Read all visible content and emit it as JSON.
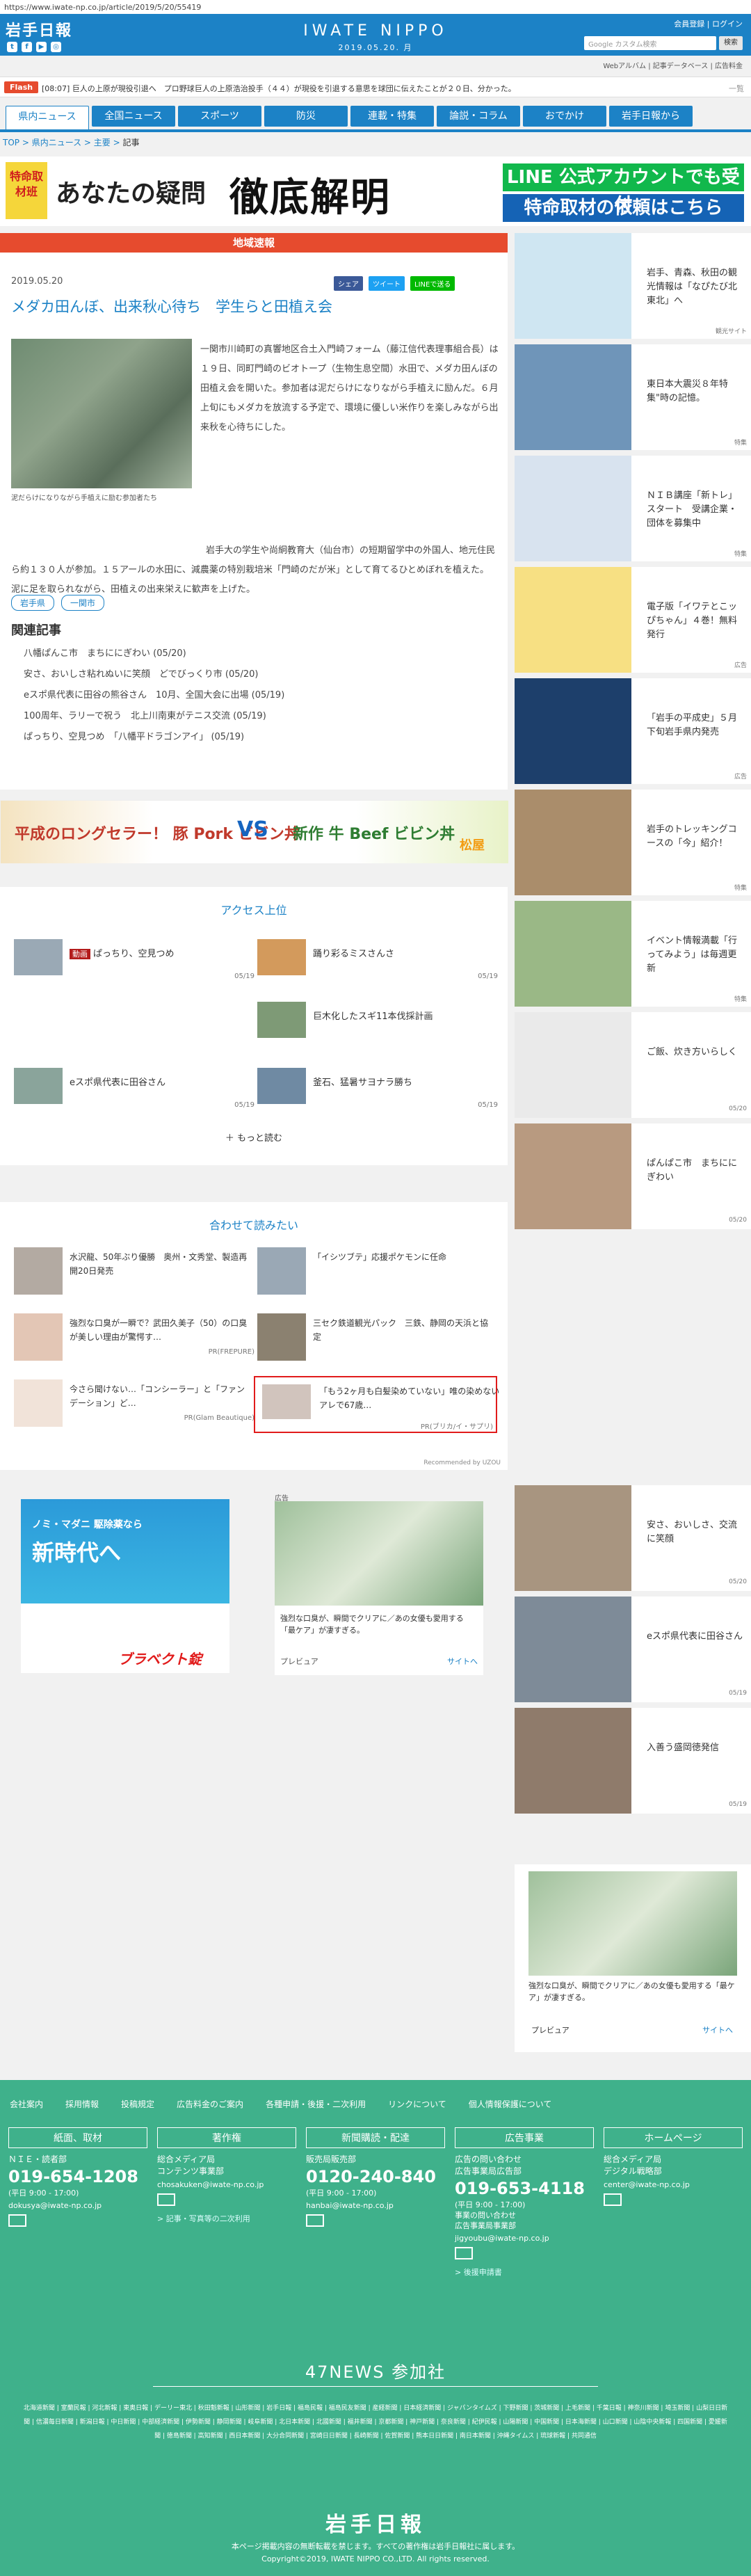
{
  "browser": {
    "url": "https://www.iwate-np.co.jp/article/2019/5/20/55419"
  },
  "header": {
    "logo": "岩手日報",
    "center_logo": "IWATE NIPPO",
    "date": "2019.05.20. 月",
    "links": "会員登録 | ログイン",
    "search_placeholder": "Google カスタム検索",
    "search_button": "検索",
    "social": [
      "t",
      "f",
      "▶",
      "◎"
    ],
    "sublinks": "Webアルバム | 記事データベース | 広告料金"
  },
  "flash": {
    "label": "Flash",
    "text": "[08:07] 巨人の上原が現役引退へ　プロ野球巨人の上原浩治投手（４４）が現役を引退する意思を球団に伝えたことが２０日、分かった。",
    "more": "一覧"
  },
  "nav": [
    "県内ニュース",
    "全国ニュース",
    "スポーツ",
    "防災",
    "連載・特集",
    "論説・コラム",
    "おでかけ",
    "岩手日報から"
  ],
  "breadcrumb": {
    "top": "TOP",
    "sep": " > ",
    "news": "県内ニュース",
    "main": "主要",
    "current": "記事"
  },
  "bannerA": {
    "tag": "特命取材班",
    "title1": "あなたの疑問",
    "title2": "徹底解明",
    "line1": "LINE 公式アカウントでも受付",
    "line2": "特命取材の依頼はこちら"
  },
  "article": {
    "section": "地域速報",
    "date": "2019.05.20",
    "share": [
      "シェア",
      "ツイート",
      "LINEで送る"
    ],
    "title": "メダカ田んぼ、出来秋心待ち　学生らと田植え会",
    "caption": "泥だらけになりながら手植えに励む参加者たち",
    "body1": "一関市川崎町の真響地区合土入門崎フォーム（藤江信代表理事組合長）は１９日、同町門崎のビオトープ（生物生息空間）水田で、メダカ田んぼの田植え会を開いた。参加者は泥だらけになりながら手植えに励んだ。６月上旬にもメダカを放流する予定で、環境に優しい米作りを楽しみながら出来秋を心待ちにした。",
    "body2": "岩手大の学生や尚絅教育大（仙台市）の短期留学中の外国人、地元住民ら約１３０人が参加。１５アールの水田に、減農薬の特別栽培米「門崎のだが米」として育てるひとめぼれを植えた。泥に足を取られながら、田植えの出来栄えに歓声を上げた。",
    "tags": [
      "岩手県",
      "一関市"
    ],
    "related_title": "関連記事",
    "related": [
      "八幡ぱんこ市　まちににぎわい (05/20)",
      "安さ、おいしさ粘れぬいに笑顔　どでびっくり市 (05/20)",
      "eスポ県代表に田谷の熊谷さん　10月、全国大会に出場 (05/19)",
      "100周年、ラリーで祝う　北上川南東がテニス交流 (05/19)",
      "ぱっちり、空見つめ　「八幡平ドラゴンアイ」 (05/19)"
    ]
  },
  "bannerB": {
    "left": "平成のロングセラー！ 豚 Pork ビビン丼",
    "vs": "VS",
    "right": "新作 牛 Beef ビビン丼",
    "brand": "松屋"
  },
  "access": {
    "title": "アクセス上位",
    "items": [
      {
        "badge": "動画",
        "text": "ぱっちり、空見つめ",
        "date": "05/19"
      },
      {
        "text": "踊り彩るミスさんさ",
        "date": "05/19"
      },
      {
        "text": "巨木化したスギ11本伐採計画",
        "date": ""
      },
      {
        "text": "eスポ県代表に田谷さん",
        "date": "05/19"
      },
      {
        "text": "釜石、猛暑サヨナラ勝ち",
        "date": "05/19"
      }
    ],
    "more": "＋ もっと読む"
  },
  "recommend": {
    "title": "合わせて読みたい",
    "items": [
      {
        "text": "水沢龍、50年ぶり優勝　奥州・文秀堂、製造再開20日発売",
        "pr": ""
      },
      {
        "text": "「イシツブテ」応援ポケモンに任命",
        "pr": ""
      },
      {
        "text": "強烈な口臭が一瞬で？武田久美子（50）の口臭が美しい理由が驚愕す…",
        "pr": "PR(FREPURE)"
      },
      {
        "text": "三セク鉄道観光パック　三鉄、静岡の天浜と協定",
        "pr": ""
      },
      {
        "text": "今さら聞けない…「コンシーラー」と「ファンデーション」ど…",
        "pr": "PR(Glam Beautique)"
      },
      {
        "text": "「もう2ヶ月も白髪染めていない」唯の染めないアレで67歳…",
        "pr": "PR(ブリカ/イ・サプリ)"
      }
    ],
    "by": "Recommended by UZOU"
  },
  "ads": {
    "ad1_line1": "ノミ・マダニ 駆除薬なら",
    "ad1_line2": "新時代へ",
    "ad1_brand": "ブラベクト錠",
    "ad_label": "広告",
    "ad2_text": "強烈な口臭が、瞬間でクリアに／あの女優も愛用する「最ケア」が凄すぎる。",
    "ad2_src": "プレビュア",
    "ad2_site": "サイトへ"
  },
  "sidebar": [
    {
      "text": "岩手、青森、秋田の観光情報は「なぴたび北東北」へ",
      "date": "観光サイト",
      "color": "#cfe6f2"
    },
    {
      "text": "東日本大震災８年特集\"時の記憶。",
      "date": "特集",
      "color": "#6f95b9"
    },
    {
      "text": "ＮＩＢ講座「新トレ」スタート　受講企業・団体を募集中",
      "date": "特集",
      "color": "#d8e3ef"
    },
    {
      "text": "電子版「イワテとこッぴちゃん」４巻！無料発行",
      "date": "広告",
      "color": "#f7e083"
    },
    {
      "text": "「岩手の平成史」５月下旬岩手県内発売",
      "date": "広告",
      "color": "#1d3f6b"
    },
    {
      "text": "岩手のトレッキングコースの「今」紹介！",
      "date": "特集",
      "color": "#aa8d6b"
    },
    {
      "text": "イベント情報満載「行ってみよう」は毎週更新",
      "date": "特集",
      "color": "#9ab886"
    },
    {
      "text": "ご飯、炊き方いらしく",
      "date": "05/20",
      "color": "#eaeaea"
    },
    {
      "text": "ぱんぱこ市　まちににぎわい",
      "date": "05/20",
      "color": "#b89a80"
    },
    {
      "text": "安さ、おいしさ、交流に笑顔",
      "date": "05/20",
      "color": "#a89580"
    },
    {
      "text": "eスポ県代表に田谷さん",
      "date": "05/19",
      "color": "#7e8b98"
    },
    {
      "text": "入善う盛岡徳発信",
      "date": "05/19",
      "color": "#8f7b6b"
    }
  ],
  "footer": {
    "links": [
      "会社案内",
      "採用情報",
      "投稿規定",
      "広告料金のご案内",
      "各種申請・後援・二次利用",
      "リンクについて",
      "個人情報保護について"
    ],
    "cols": [
      {
        "head": "紙面、取材",
        "sub": "ＮＩＥ・読者部",
        "phone": "019-654-1208",
        "hours": "(平日 9:00 - 17:00)",
        "mail": "dokusya@iwate-np.co.jp",
        "link": ""
      },
      {
        "head": "著作権",
        "sub": "総合メディア局\nコンテンツ事業部",
        "phone": "",
        "hours": "",
        "mail": "chosakuken@iwate-np.co.jp",
        "link": "> 記事・写真等の二次利用"
      },
      {
        "head": "新聞購読・配達",
        "sub": "販売局販売部",
        "phone": "0120-240-840",
        "hours": "(平日 9:00 - 17:00)",
        "mail": "hanbai@iwate-np.co.jp",
        "link": ""
      },
      {
        "head": "広告事業",
        "sub": "広告の問い合わせ\n広告事業局広告部",
        "phone": "019-653-4118",
        "hours": "(平日 9:00 - 17:00)\n事業の問い合わせ\n広告事業局事業部",
        "mail": "jigyoubu@iwate-np.co.jp",
        "link": "> 後援申請書"
      },
      {
        "head": "ホームページ",
        "sub": "総合メディア局\nデジタル戦略部",
        "phone": "",
        "hours": "",
        "mail": "center@iwate-np.co.jp",
        "link": ""
      }
    ],
    "news47": "47NEWS 参加社",
    "papers": "北海道新聞 | 室蘭民報 | 河北新報 | 東奥日報 | デーリー東北 | 秋田魁新報 | 山形新聞 | 岩手日報 | 福島民報 | 福島民友新聞 | 産経新聞 | 日本経済新聞 | ジャパンタイムズ | 下野新聞 | 茨城新聞 | 上毛新聞 | 千葉日報 | 神奈川新聞 | 埼玉新聞 | 山梨日日新聞 | 信濃毎日新聞 | 新潟日報 | 中日新聞 | 中部経済新聞 | 伊勢新聞 | 静岡新聞 | 岐阜新聞 | 北日本新聞 | 北國新聞 | 福井新聞 | 京都新聞 | 神戸新聞 | 奈良新聞 | 紀伊民報 | 山陽新聞 | 中国新聞 | 日本海新聞 | 山口新聞 | 山陰中央新報 | 四国新聞 | 愛媛新聞 | 徳島新聞 | 高知新聞 | 西日本新聞 | 大分合同新聞 | 宮崎日日新聞 | 長崎新聞 | 佐賀新聞 | 熊本日日新聞 | 南日本新聞 | 沖縄タイムス | 琉球新報 | 共同通信",
    "logo": "岩手日報",
    "note": "本ページ掲載内容の無断転載を禁じます。すべての著作権は岩手日報社に属します。",
    "copyright": "Copyright©2019, IWATE NIPPO CO.,LTD. All rights reserved."
  }
}
